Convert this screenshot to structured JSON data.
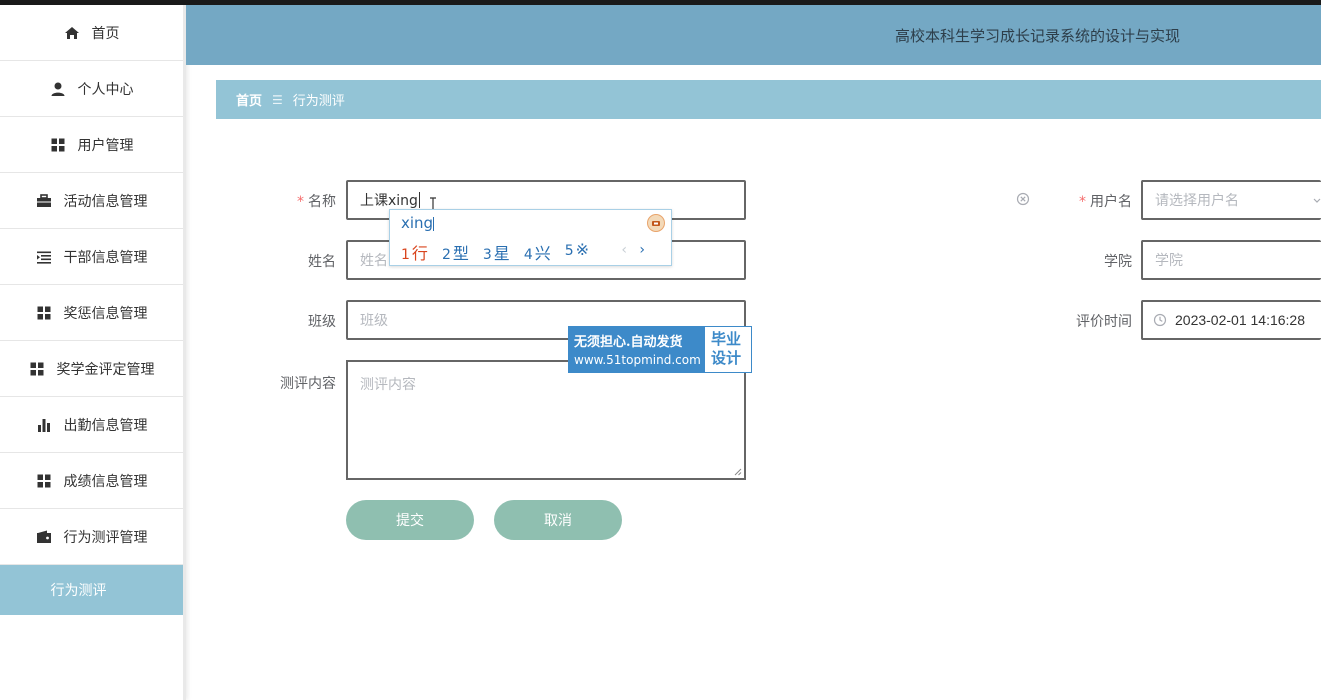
{
  "header": {
    "title": "高校本科生学习成长记录系统的设计与实现"
  },
  "sidebar": {
    "items": [
      {
        "label": "首页",
        "icon": "home-icon"
      },
      {
        "label": "个人中心",
        "icon": "user-icon"
      },
      {
        "label": "用户管理",
        "icon": "grid-icon"
      },
      {
        "label": "活动信息管理",
        "icon": "briefcase-icon"
      },
      {
        "label": "干部信息管理",
        "icon": "list-icon"
      },
      {
        "label": "奖惩信息管理",
        "icon": "grid-icon"
      },
      {
        "label": "奖学金评定管理",
        "icon": "grid-icon"
      },
      {
        "label": "出勤信息管理",
        "icon": "bar-chart-icon"
      },
      {
        "label": "成绩信息管理",
        "icon": "grid-icon"
      },
      {
        "label": "行为测评管理",
        "icon": "wallet-icon"
      }
    ],
    "active_sub": {
      "label": "行为测评"
    }
  },
  "breadcrumb": {
    "home": "首页",
    "separator": "☰",
    "current": "行为测评"
  },
  "form": {
    "name": {
      "label": "名称",
      "value": "上课xing"
    },
    "username": {
      "label": "用户名",
      "placeholder": "请选择用户名"
    },
    "fullname": {
      "label": "姓名",
      "placeholder": "姓名"
    },
    "college": {
      "label": "学院",
      "placeholder": "学院"
    },
    "class": {
      "label": "班级",
      "placeholder": "班级"
    },
    "eval_time": {
      "label": "评价时间",
      "value": "2023-02-01 14:16:28"
    },
    "content": {
      "label": "测评内容",
      "placeholder": "测评内容"
    },
    "required_mark": "*",
    "submit_label": "提交",
    "cancel_label": "取消"
  },
  "ime": {
    "composition": "xing",
    "candidates": [
      {
        "num": "1",
        "text": "行"
      },
      {
        "num": "2",
        "text": "型"
      },
      {
        "num": "3",
        "text": "星"
      },
      {
        "num": "4",
        "text": "兴"
      },
      {
        "num": "5",
        "text": "※"
      }
    ],
    "prev": "‹",
    "next": "›"
  },
  "watermark": {
    "line1": "无须担心.自动发货",
    "line2": "www.51topmind.com",
    "right1": "毕业",
    "right2": "设计"
  },
  "colors": {
    "header_bg": "#74a8c4",
    "breadcrumb_bg": "#93c4d6",
    "button_bg": "#8fbfb0",
    "required": "#f56c6c"
  }
}
